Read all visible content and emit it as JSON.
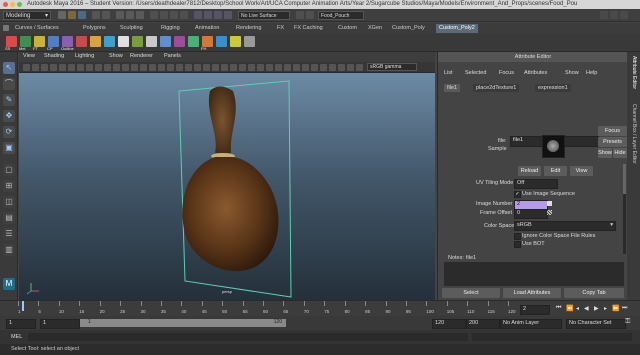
{
  "window": {
    "title": "Autodesk Maya 2016 – Student Version: /Users/deathdealer7812/Desktop/School Work/Art/UCA Computer Animation Arts/Year 2/Sugarcube Studios/Maya/Models/Environment_And_Props/scenes/Food_Pou"
  },
  "status_line": {
    "menu_set": "Modeling",
    "live_surface": "No Live Surface",
    "object_name": "Food_Pouch"
  },
  "shelf_tabs": [
    "Curves / Surfaces",
    "Polygons",
    "Sculpting",
    "Rigging",
    "Animation",
    "Rendering",
    "FX",
    "FX Caching",
    "Custom",
    "XGen",
    "Custom_Poly",
    "Custom_Poly2"
  ],
  "active_shelf_tab": "Custom_Poly2",
  "shelf_buttons": [
    {
      "label": "SS",
      "color": "#d94a4a"
    },
    {
      "label": "Mel",
      "color": "#3f8f4f"
    },
    {
      "label": "FT",
      "color": "#c9b13a"
    },
    {
      "label": "CP",
      "color": "#4f7fc9"
    },
    {
      "label": "Outline",
      "color": "#8a5fb0"
    },
    {
      "label": "",
      "color": "#c84a4a"
    },
    {
      "label": "",
      "color": "#d9a53a"
    },
    {
      "label": "",
      "color": "#3fa0c9"
    },
    {
      "label": "",
      "color": "#e0e0e0"
    },
    {
      "label": "",
      "color": "#7a9f3a"
    },
    {
      "label": "",
      "color": "#c9c9c9"
    },
    {
      "label": "",
      "color": "#5f8fd0"
    },
    {
      "label": "",
      "color": "#a04a9a"
    },
    {
      "label": "",
      "color": "#49b07a"
    },
    {
      "label": "FH",
      "color": "#d07a3a"
    },
    {
      "label": "",
      "color": "#3a8fc9"
    },
    {
      "label": "",
      "color": "#c9c93a"
    },
    {
      "label": "",
      "color": "#9a9a9a"
    }
  ],
  "viewport": {
    "menus": [
      "View",
      "Shading",
      "Lighting",
      "Show",
      "Renderer",
      "Panels"
    ],
    "color_space": "sRGB gamma",
    "camera_label": "persp"
  },
  "attribute_editor": {
    "title": "Attribute Editor",
    "menus": [
      "List",
      "Selected",
      "Focus",
      "Attributes",
      "Show",
      "Help"
    ],
    "tabs": [
      "file1",
      "place2dTexture1",
      "expression1"
    ],
    "active_tab": "file1",
    "file_label": "file:",
    "file_value": "file1",
    "focus": "Focus",
    "presets": "Presets",
    "show": "Show",
    "hide": "Hide",
    "sample_label": "Sample",
    "reload": "Reload",
    "edit": "Edit",
    "view": "View",
    "uv_tiling_label": "UV Tiling Mode",
    "uv_tiling_value": "Off",
    "use_image_sequence": "Use Image Sequence",
    "image_number_label": "Image Number",
    "image_number_value": "2",
    "frame_offset_label": "Frame Offset",
    "frame_offset_value": "0",
    "color_space_label": "Color Space",
    "color_space_value": "sRGB",
    "ignore_cs": "Ignore Color Space File Rules",
    "use_bot": "Use BOT",
    "notes_label": "Notes:",
    "notes_value": "file1",
    "select": "Select",
    "load_attributes": "Load Attributes",
    "copy_tab": "Copy Tab"
  },
  "side_tabs": [
    "Attribute Editor",
    "Channel Box / Layer Editor"
  ],
  "timeline": {
    "ticks": [
      "1",
      "5",
      "10",
      "15",
      "20",
      "25",
      "30",
      "35",
      "40",
      "45",
      "50",
      "55",
      "60",
      "65",
      "70",
      "75",
      "80",
      "85",
      "90",
      "95",
      "100",
      "105",
      "110",
      "115",
      "120"
    ],
    "current_frame": "2"
  },
  "range": {
    "start": "1",
    "playback_start": "1",
    "range_left": "1",
    "range_right": "120",
    "playback_end": "120",
    "end": "200",
    "anim_layer": "No Anim Layer",
    "character_set": "No Character Set"
  },
  "mel_label": "MEL",
  "help_line": "Select Tool: select an object"
}
